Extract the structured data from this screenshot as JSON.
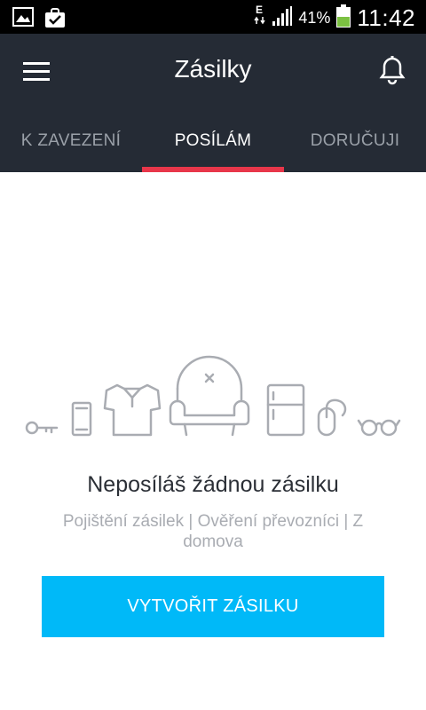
{
  "status_bar": {
    "battery_percent": "41%",
    "time": "11:42",
    "icons": [
      "gallery-icon",
      "shopping-bag-check-icon",
      "data-transfer-icon",
      "signal-icon",
      "battery-icon"
    ]
  },
  "app_bar": {
    "title": "Zásilky",
    "menu_icon": "menu-icon",
    "notification_icon": "bell-icon"
  },
  "tabs": [
    {
      "label": "K ZAVEZENÍ",
      "active": false
    },
    {
      "label": "POSÍLÁM",
      "active": true
    },
    {
      "label": "DORUČUJI",
      "active": false
    }
  ],
  "empty_state": {
    "title": "Neposíláš žádnou zásilku",
    "subtitle": "Pojištění zásilek | Ověření převozníci | Z domova",
    "illustration_icons": [
      "key-icon",
      "phone-icon",
      "shirt-icon",
      "armchair-icon",
      "fridge-icon",
      "mouse-icon",
      "glasses-icon"
    ]
  },
  "cta": {
    "label": "VYTVOŘIT ZÁSILKU"
  },
  "colors": {
    "app_bar": "#252b35",
    "tab_indicator": "#e8364a",
    "cta": "#00b9f8"
  }
}
